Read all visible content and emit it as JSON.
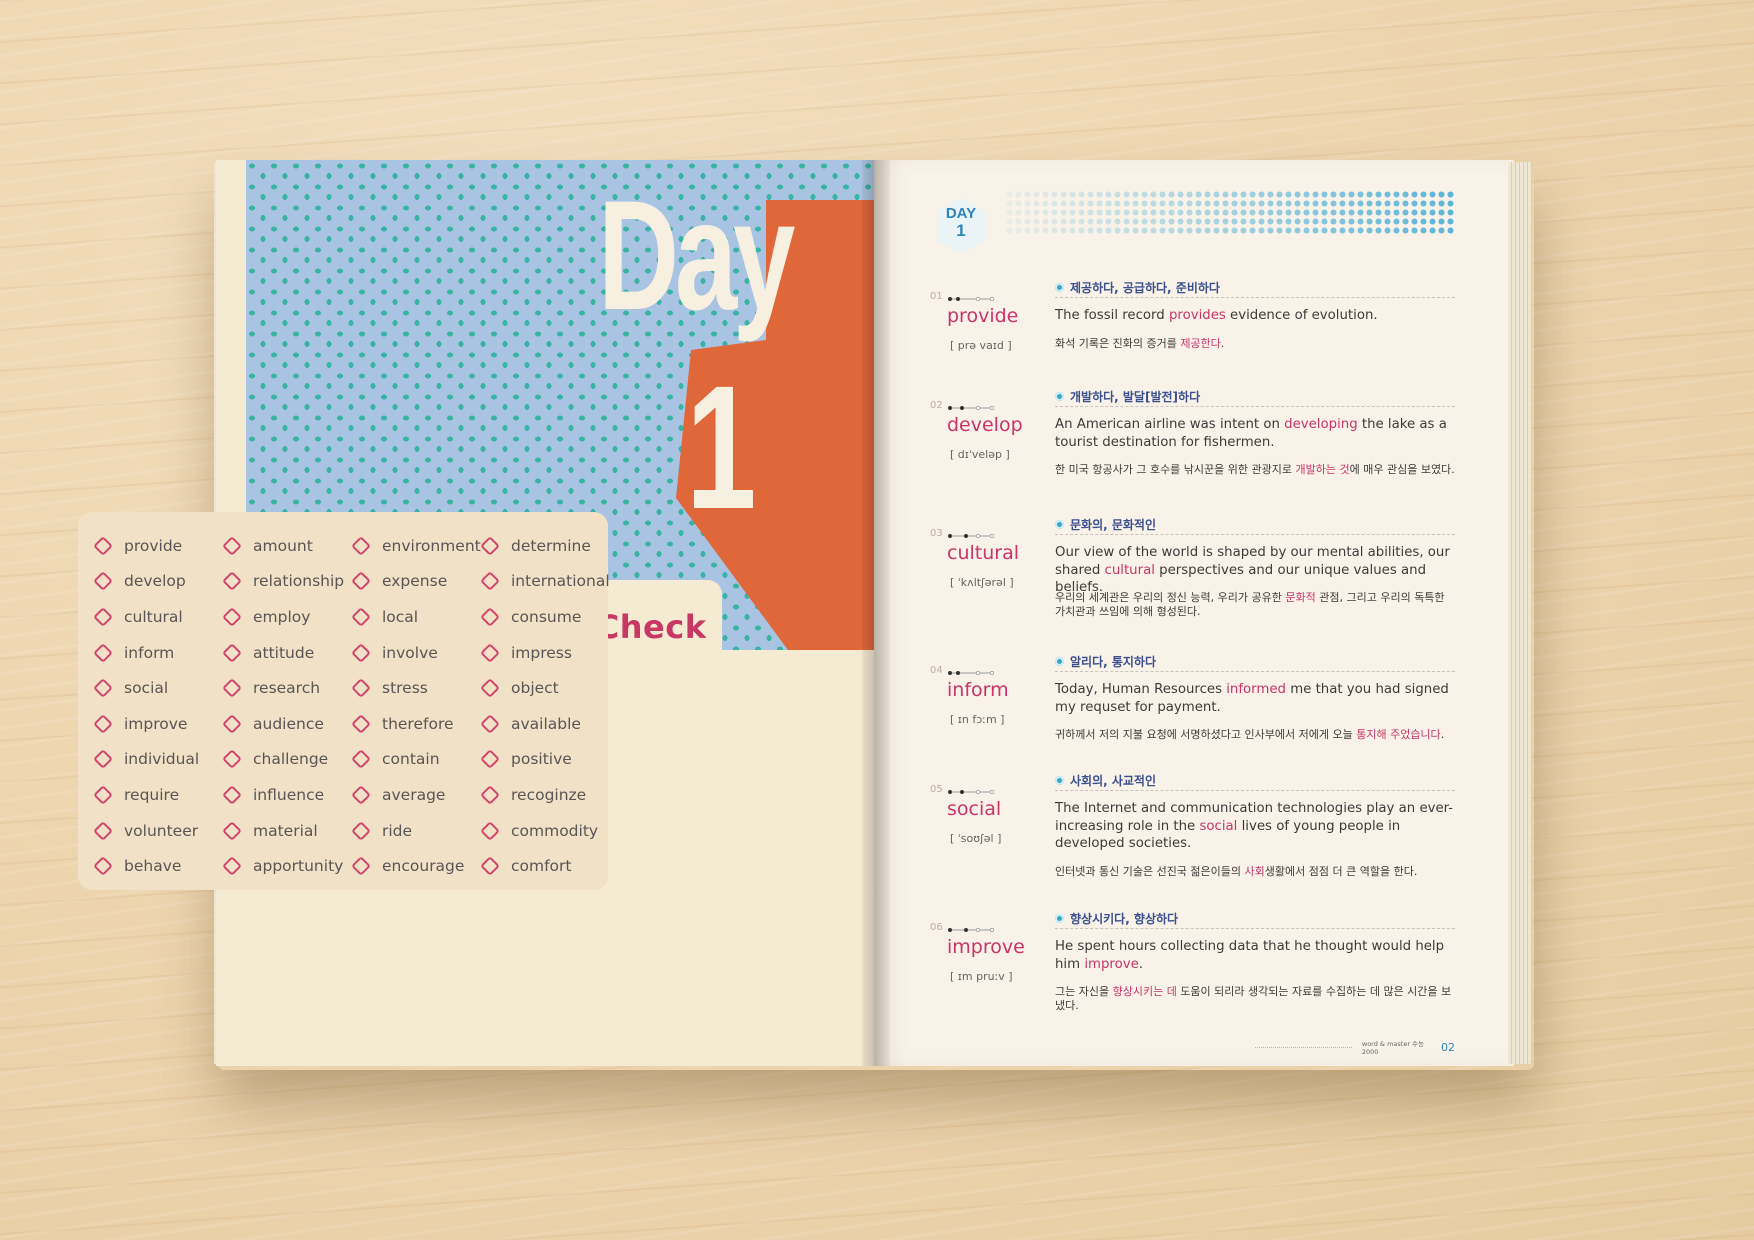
{
  "left_page": {
    "day_word": "Day",
    "day_number": "1",
    "check_title": "Previous Check",
    "words": [
      "provide",
      "amount",
      "environment",
      "determine",
      "develop",
      "relationship",
      "expense",
      "international",
      "cultural",
      "employ",
      "local",
      "consume",
      "inform",
      "attitude",
      "involve",
      "impress",
      "social",
      "research",
      "stress",
      "object",
      "improve",
      "audience",
      "therefore",
      "available",
      "individual",
      "challenge",
      "contain",
      "positive",
      "require",
      "influence",
      "average",
      "recoginze",
      "volunteer",
      "material",
      "ride",
      "commodity",
      "behave",
      "apportunity",
      "encourage",
      "comfort"
    ]
  },
  "right_page": {
    "badge": {
      "label": "DAY",
      "number": "1"
    },
    "entries": [
      {
        "num": "01",
        "word": "provide",
        "pron": "[ prə vaɪd ]",
        "meaning": "제공하다, 공급하다, 준비하다",
        "en": [
          "The fossil record ",
          "provides",
          " evidence of evolution."
        ],
        "ko": [
          "화석 기록은 진화의 증거를 ",
          "제공한다",
          "."
        ]
      },
      {
        "num": "02",
        "word": "develop",
        "pron": "[ dɪˈveləp ]",
        "meaning": "개발하다, 발달[발전]하다",
        "en": [
          "An American airline was intent on ",
          "developing",
          " the lake as a tourist destination for fishermen."
        ],
        "ko": [
          "한 미국 항공사가 그 호수를 낚시꾼을 위한 관광지로 ",
          "개발하는 것",
          "에 매우 관심을 보였다."
        ]
      },
      {
        "num": "03",
        "word": "cultural",
        "pron": "[ ˈkʌltʃərəl ]",
        "meaning": "문화의, 문화적인",
        "en": [
          "Our view of the world is shaped by our mental abilities, our shared ",
          "cultural",
          " perspectives and our unique values and beliefs."
        ],
        "ko": [
          "우리의 세계관은 우리의 정신 능력, 우리가 공유한 ",
          "문화적",
          " 관점, 그리고 우리의 독특한 가치관과 쓰임에 의해 형성된다."
        ]
      },
      {
        "num": "04",
        "word": "inform",
        "pron": "[ ɪn fɔːm ]",
        "meaning": "알리다, 통지하다",
        "en": [
          "Today, Human Resources ",
          "informed",
          " me that you had signed my requset for payment."
        ],
        "ko": [
          "귀하께서 저의 지불 요청에 서명하셨다고 인사부에서 저에게 오늘 ",
          "통지해 주었습니다",
          "."
        ]
      },
      {
        "num": "05",
        "word": "social",
        "pron": "[ ˈsoʊʃəl ]",
        "meaning": "사회의, 사교적인",
        "en": [
          "The Internet and communication technologies play an ever-increasing role in the ",
          "social",
          " lives of young people in developed societies."
        ],
        "ko": [
          "인터넷과 통신 기술은 선진국 젊은이들의 ",
          "사회",
          "생활에서 점점 더 큰 역할을 한다."
        ]
      },
      {
        "num": "06",
        "word": "improve",
        "pron": "[ ɪm pruːv ]",
        "meaning": "향상시키다, 향상하다",
        "en": [
          "He spent hours collecting data that he thought would help him ",
          "improve",
          "."
        ],
        "ko": [
          "그는 자신을 ",
          "향상시키는 데",
          " 도움이 되리라 생각되는 자료를 수집하는 데 많은 시간을 보냈다."
        ]
      }
    ],
    "footer": {
      "text": "word & master 수능 2000",
      "page": "02"
    }
  },
  "colors": {
    "accent_pink": "#c8346a",
    "accent_blue": "#2e86b8",
    "orange": "#e0673a",
    "pattern_blue": "#a9c4e3",
    "pattern_teal": "#39b3a2"
  }
}
